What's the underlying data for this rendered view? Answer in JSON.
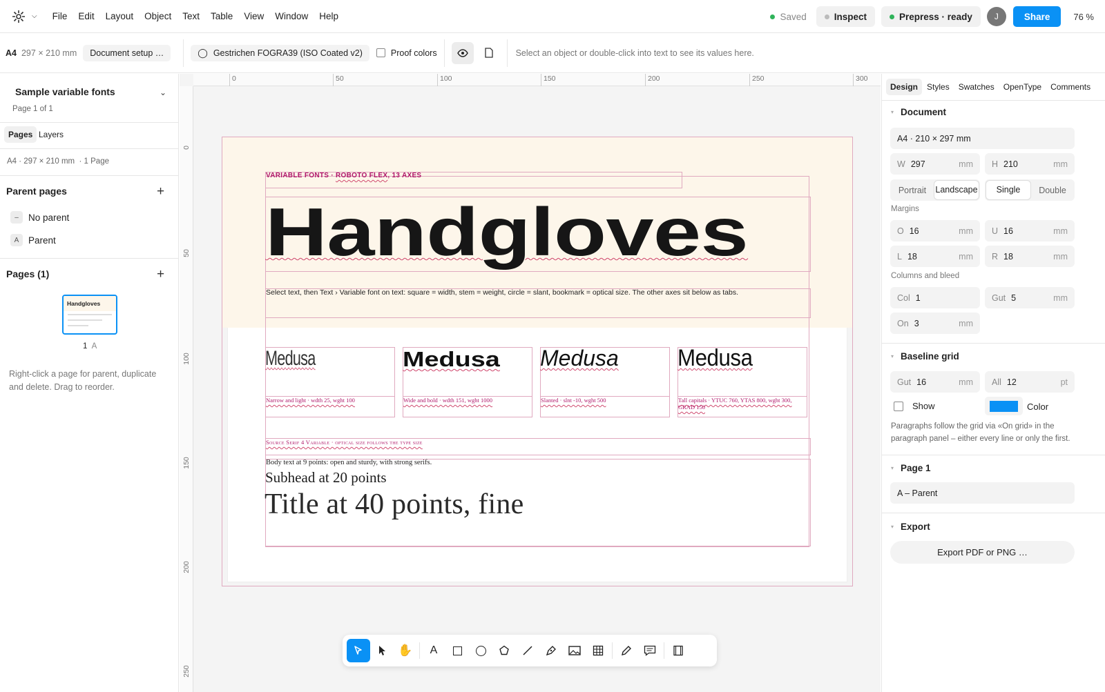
{
  "menu": {
    "items": [
      "File",
      "Edit",
      "Layout",
      "Object",
      "Text",
      "Table",
      "View",
      "Window",
      "Help"
    ]
  },
  "status": {
    "saved": "Saved",
    "inspect": "Inspect",
    "prepress": "Prepress · ready",
    "avatar": "J",
    "share": "Share",
    "zoom": "76 %"
  },
  "toolbar": {
    "paper_label": "A4",
    "paper_size": "297 × 210 mm",
    "doc_setup": "Document setup …",
    "color_profile": "Gestrichen FOGRA39 (ISO Coated v2)",
    "proof": "Proof colors",
    "hint": "Select an object or double-click into text to see its values here."
  },
  "left": {
    "doc_title": "Sample variable fonts",
    "page_info": "Page 1 of 1",
    "tabs": [
      "Pages",
      "Layers"
    ],
    "page_meta": "A4 · 297 × 210 mm  · 1 Page",
    "parent_pages_title": "Parent pages",
    "parents": [
      {
        "badge": "–",
        "label": "No parent"
      },
      {
        "badge": "A",
        "label": "Parent"
      }
    ],
    "pages_title": "Pages (1)",
    "thumb_title": "Handgloves",
    "thumb_label": "1",
    "thumb_parent": "A",
    "help": "Right-click a page for parent, duplicate and delete. Drag to reorder."
  },
  "ruler": {
    "top": [
      "0",
      "50",
      "100",
      "150",
      "200",
      "250",
      "300"
    ],
    "left": [
      "0",
      "50",
      "100",
      "150",
      "200",
      "250"
    ]
  },
  "page": {
    "kicker_a": "VARIABLE FONTS · ",
    "kicker_b": "ROBOTO FLEX",
    "kicker_c": ", 13 AXES",
    "headline": "Handgloves",
    "instructions": "Select text, then Text › Variable font on text: square = width, stem = weight, circle = slant, bookmark = optical size. The other axes sit below as tabs.",
    "samples": [
      {
        "word": "Medusa",
        "caption": "Narrow and light · wdth 25, wght 100"
      },
      {
        "word": "Medusa",
        "caption": "Wide and bold · wdth 151, wght 1000"
      },
      {
        "word": "Medusa",
        "caption": "Slanted · slnt -10, wght 500"
      },
      {
        "word": "Medusa",
        "caption": "Tall capitals · YTUC 760, YTAS 800, wght 300, GRAD 150"
      }
    ],
    "serif_kicker": "Source Serif 4 Variable · optical size follows the type size",
    "body9": "Body text at 9 points: open and sturdy, with strong serifs.",
    "sub20": "Subhead at 20 points",
    "title40": "Title at 40 points, fine"
  },
  "right": {
    "tabs": [
      "Design",
      "Styles",
      "Swatches",
      "OpenType",
      "Comments"
    ],
    "document_title": "Document",
    "format": "A4 · 210 × 297 mm",
    "w_label": "W",
    "w": "297",
    "h_label": "H",
    "h": "210",
    "unit": "mm",
    "orientation": [
      "Portrait",
      "Landscape"
    ],
    "sides": [
      "Single",
      "Double"
    ],
    "margins_title": "Margins",
    "margins": [
      {
        "l": "O",
        "v": "16"
      },
      {
        "l": "U",
        "v": "16"
      },
      {
        "l": "L",
        "v": "18"
      },
      {
        "l": "R",
        "v": "18"
      }
    ],
    "columns_title": "Columns and bleed",
    "col_label": "Col",
    "col": "1",
    "gut_label": "Gut",
    "gut": "5",
    "on_label": "On",
    "on": "3",
    "baseline_title": "Baseline grid",
    "bgut_label": "Gut",
    "bgut": "16",
    "all_label": "All",
    "all": "12",
    "pt": "pt",
    "show": "Show",
    "color": "Color",
    "grid_color": "#0a91f5",
    "grid_note": "Paragraphs follow the grid via «On grid» in the paragraph panel – either every line or only the first.",
    "page_title": "Page 1",
    "page_parent": "A – Parent",
    "export_title": "Export",
    "export_btn": "Export PDF or PNG …"
  },
  "colors": {
    "accent": "#0a91f5",
    "guide": "#e0a9bf",
    "kicker": "#b0186a",
    "page_top": "#fdf6ea"
  }
}
